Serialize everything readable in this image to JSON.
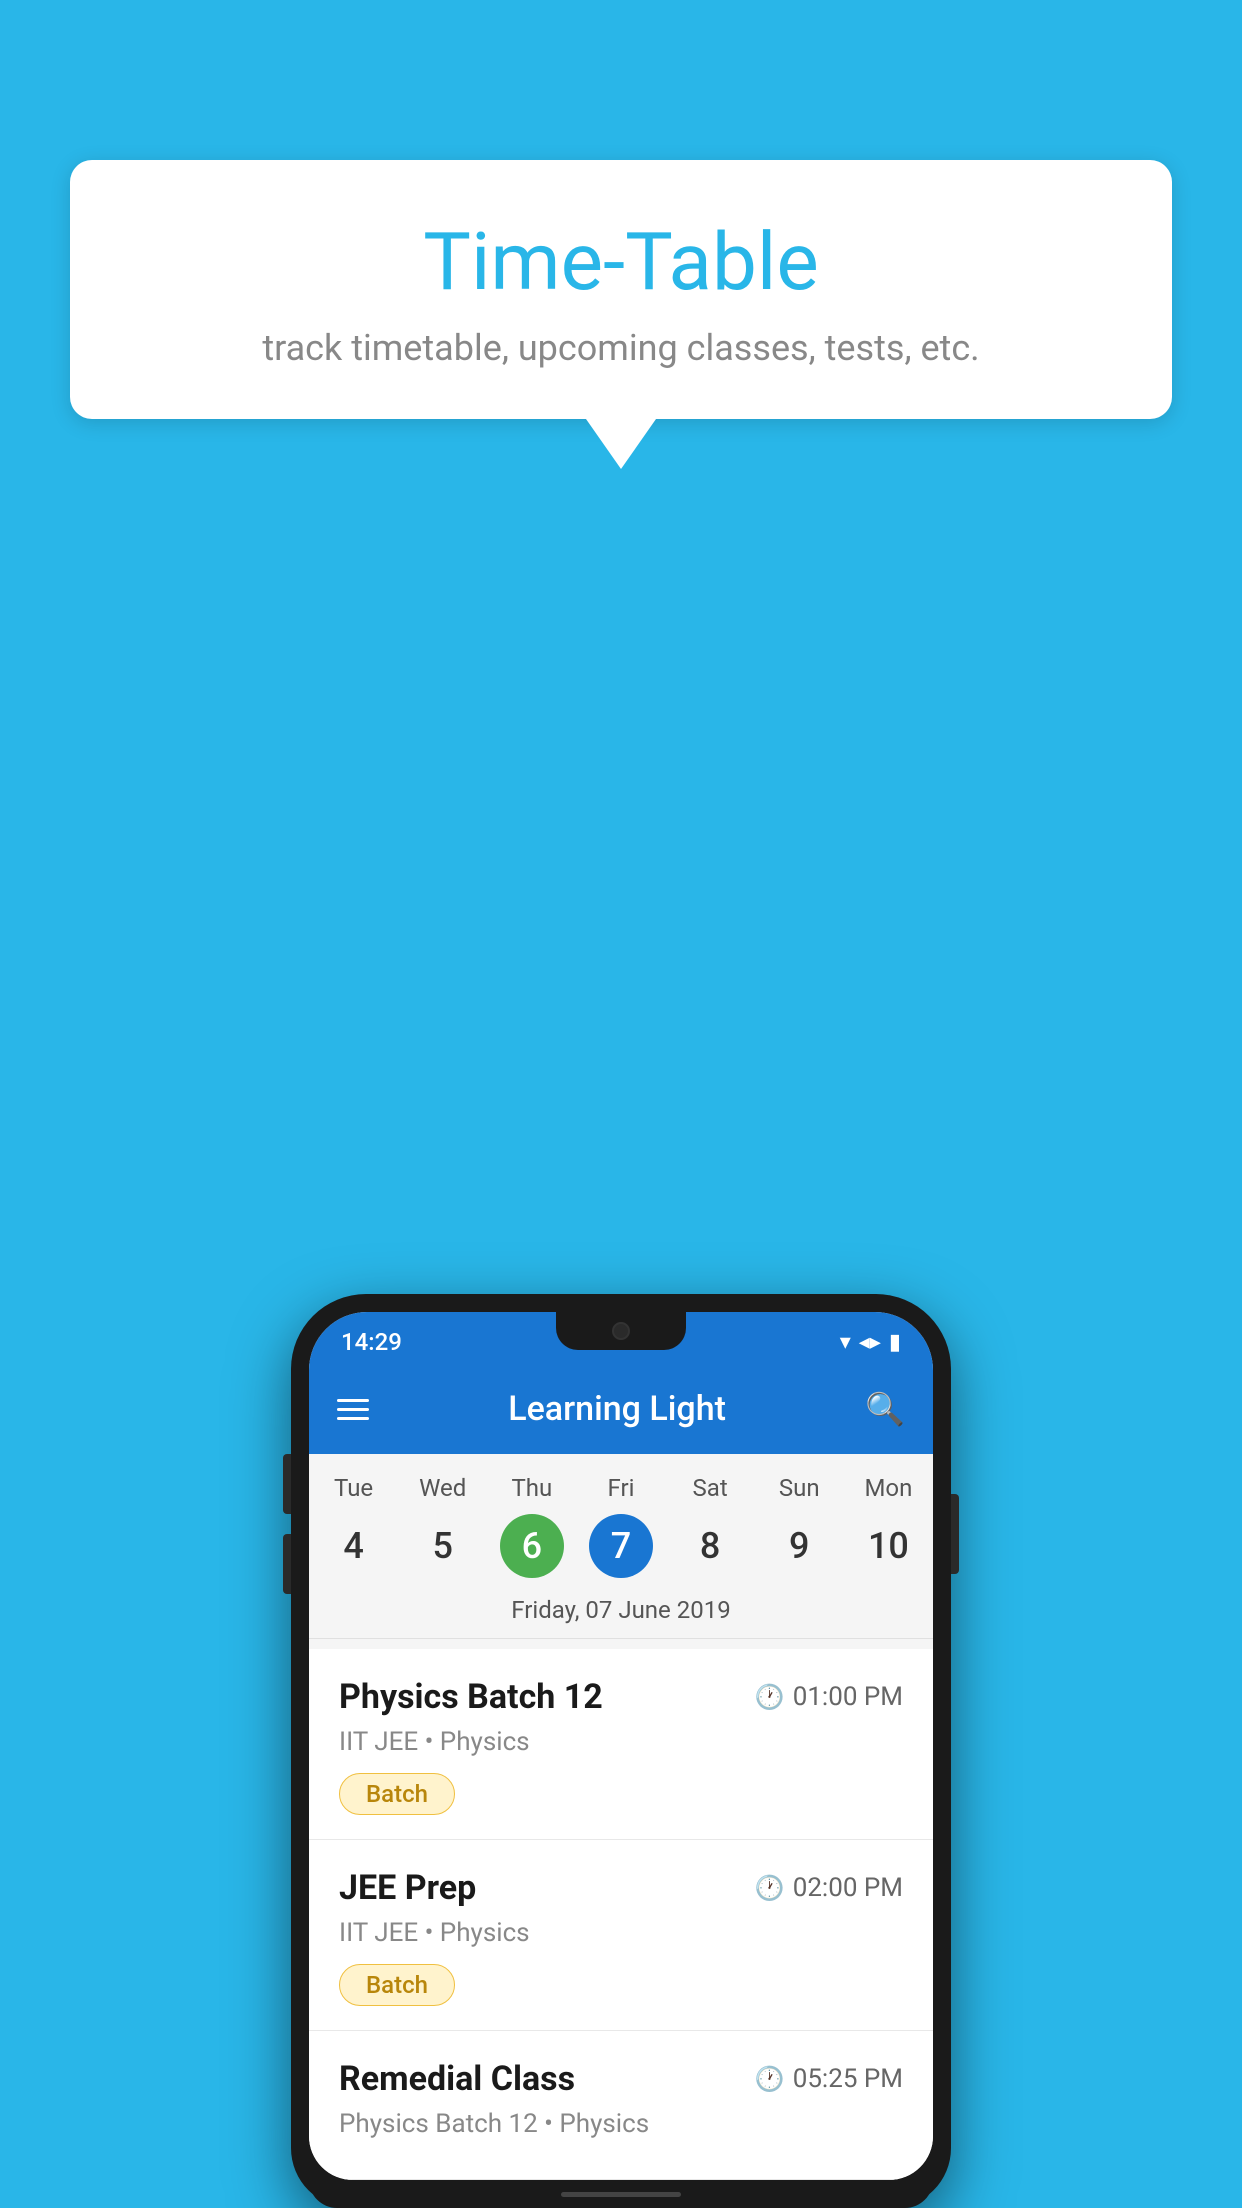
{
  "background_color": "#29b6e8",
  "speech_bubble": {
    "title": "Time-Table",
    "subtitle": "track timetable, upcoming classes, tests, etc."
  },
  "phone": {
    "status_bar": {
      "time": "14:29"
    },
    "app_bar": {
      "title": "Learning Light"
    },
    "calendar": {
      "days": [
        {
          "name": "Tue",
          "number": "4",
          "state": "normal"
        },
        {
          "name": "Wed",
          "number": "5",
          "state": "normal"
        },
        {
          "name": "Thu",
          "number": "6",
          "state": "today"
        },
        {
          "name": "Fri",
          "number": "7",
          "state": "selected"
        },
        {
          "name": "Sat",
          "number": "8",
          "state": "normal"
        },
        {
          "name": "Sun",
          "number": "9",
          "state": "normal"
        },
        {
          "name": "Mon",
          "number": "10",
          "state": "normal"
        }
      ],
      "selected_date_label": "Friday, 07 June 2019"
    },
    "schedule_items": [
      {
        "title": "Physics Batch 12",
        "time": "01:00 PM",
        "meta": "IIT JEE • Physics",
        "badge": "Batch"
      },
      {
        "title": "JEE Prep",
        "time": "02:00 PM",
        "meta": "IIT JEE • Physics",
        "badge": "Batch"
      },
      {
        "title": "Remedial Class",
        "time": "05:25 PM",
        "meta": "Physics Batch 12 • Physics",
        "badge": null
      }
    ]
  }
}
